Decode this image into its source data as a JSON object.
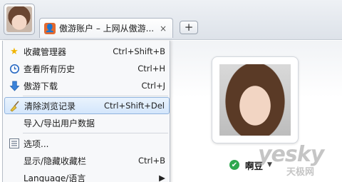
{
  "tabbar": {
    "tab_title": "傲游账户 – 上网从傲游...",
    "close_glyph": "×",
    "new_tab_glyph": "+"
  },
  "menu": {
    "items": [
      {
        "label": "收藏管理器",
        "shortcut": "Ctrl+Shift+B",
        "icon": "star-icon"
      },
      {
        "label": "查看所有历史",
        "shortcut": "Ctrl+H",
        "icon": "clock-icon"
      },
      {
        "label": "傲游下载",
        "shortcut": "Ctrl+J",
        "icon": "download-arrow-icon"
      },
      {
        "label": "清除浏览记录",
        "shortcut": "Ctrl+Shift+Del",
        "icon": "broom-icon",
        "highlighted": true
      },
      {
        "label": "导入/导出用户数据",
        "shortcut": ""
      },
      {
        "label": "选项...",
        "shortcut": "",
        "icon": "list-icon"
      },
      {
        "label": "显示/隐藏收藏栏",
        "shortcut": "Ctrl+B"
      },
      {
        "label": "Language/语言",
        "shortcut": "▶"
      }
    ]
  },
  "profile": {
    "username": "啊豆",
    "status": "online"
  },
  "watermark": {
    "main": "yesky",
    "sub": "天极网"
  },
  "colors": {
    "highlight_border": "#8fb3de",
    "tab_icon": "#e46a2f",
    "status_green": "#2fa84f"
  }
}
